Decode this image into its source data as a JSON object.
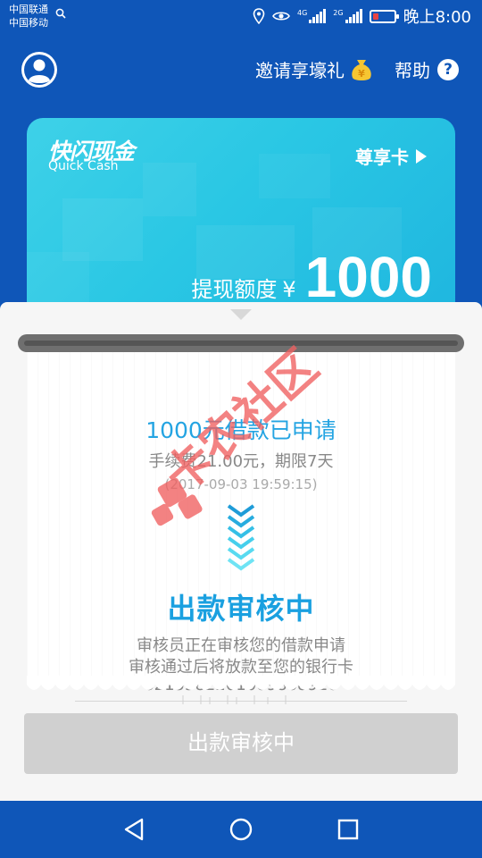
{
  "status_bar": {
    "carrier_1": "中国联通",
    "carrier_2": "中国移动",
    "signal_1_label": "4G",
    "signal_2_label": "2G",
    "time": "晚上8:00"
  },
  "header": {
    "invite_label": "邀请享壕礼",
    "help_label": "帮助",
    "help_icon_glyph": "?",
    "gift_icon_glyph": "¥"
  },
  "card": {
    "brand_cn": "快闪现金",
    "brand_en": "Quick Cash",
    "badge_label": "尊享卡",
    "limit_label": "提现额度",
    "currency": "¥",
    "limit_amount": "1000"
  },
  "receipt": {
    "title": "1000元借款已申请",
    "fee_line": "手续费21.00元，期限7天",
    "timestamp": "(2017-09-03 19:59:15)",
    "status": "出款审核中",
    "desc_line_1": "审核员正在审核您的借款申请",
    "desc_line_2": "审核通过后将放款至您的银行卡",
    "card_number": "6215582201009868926"
  },
  "watermark_text": "卡农社区",
  "main_button": {
    "label": "出款审核中"
  },
  "colors": {
    "primary_blue": "#0f56b8",
    "card_cyan": "#2ac7e4",
    "accent_blue": "#1aa0e0",
    "button_disabled": "#d0d0d0",
    "watermark_red": "#f06060"
  }
}
